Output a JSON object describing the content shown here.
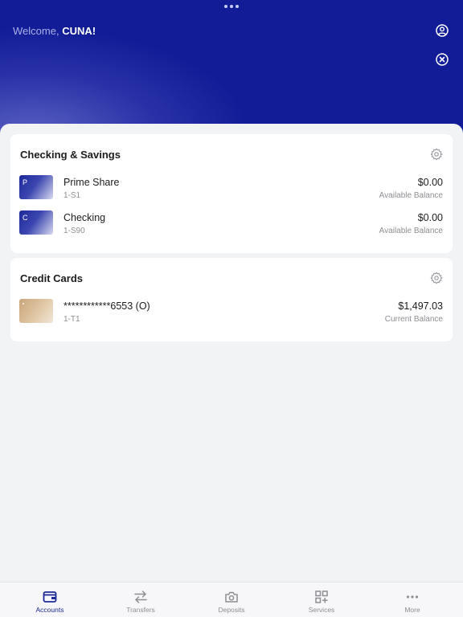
{
  "header": {
    "welcome_prefix": "Welcome,",
    "user_name": "CUNA!",
    "icons": {
      "user": "user-circle-icon",
      "close": "close-circle-icon"
    }
  },
  "checking_savings": {
    "title": "Checking & Savings",
    "accounts": [
      {
        "initial": "P",
        "name": "Prime Share",
        "id": "1-S1",
        "amount": "$0.00",
        "balance_label": "Available Balance"
      },
      {
        "initial": "C",
        "name": "Checking",
        "id": "1-S90",
        "amount": "$0.00",
        "balance_label": "Available Balance"
      }
    ]
  },
  "credit_cards": {
    "title": "Credit Cards",
    "accounts": [
      {
        "name": "************6553 (O)",
        "id": "1-T1",
        "amount": "$1,497.03",
        "balance_label": "Current Balance"
      }
    ]
  },
  "tabbar": {
    "tabs": [
      {
        "label": "Accounts",
        "icon": "wallet-icon",
        "active": true
      },
      {
        "label": "Transfers",
        "icon": "transfer-arrows-icon",
        "active": false
      },
      {
        "label": "Deposits",
        "icon": "camera-icon",
        "active": false
      },
      {
        "label": "Services",
        "icon": "grid-plus-icon",
        "active": false
      },
      {
        "label": "More",
        "icon": "more-dots-icon",
        "active": false
      }
    ]
  },
  "colors": {
    "header_bg": "#111c96",
    "active_tab": "#1d2a9a",
    "page_bg": "#f2f3f5"
  }
}
